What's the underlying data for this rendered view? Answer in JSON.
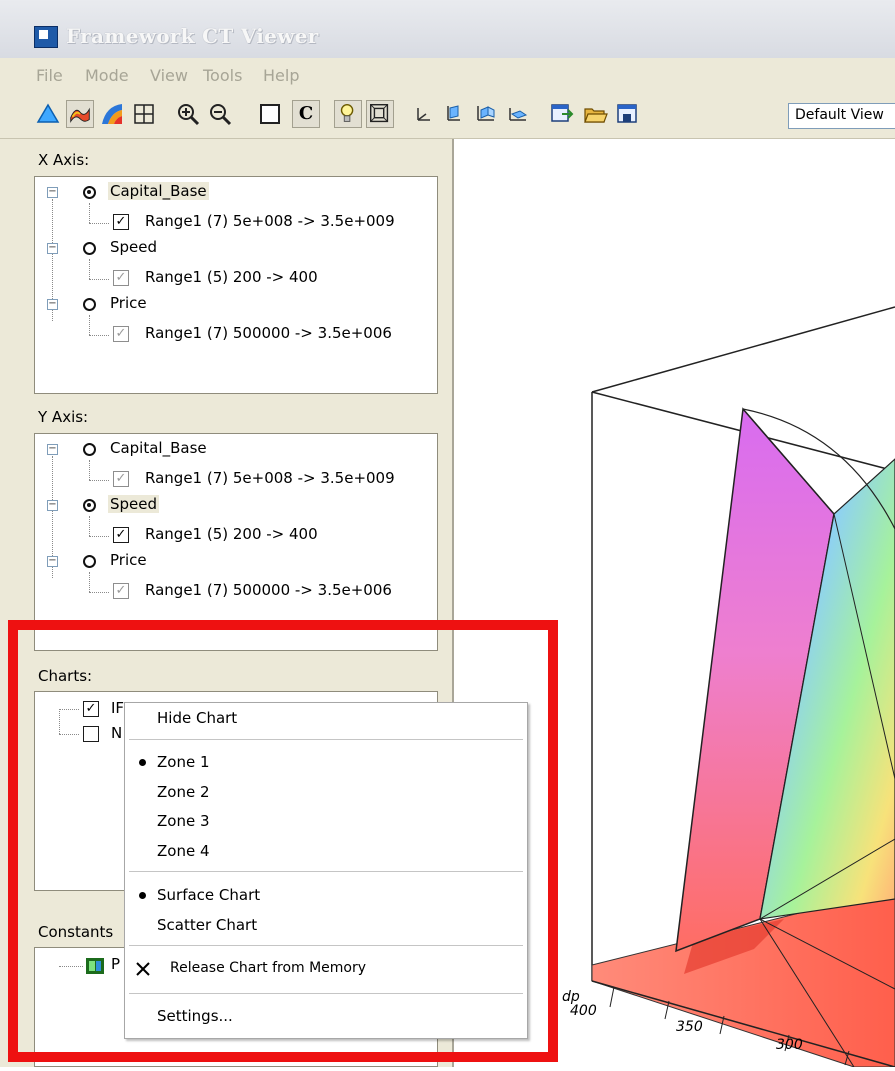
{
  "window": {
    "title": "Framework CT Viewer"
  },
  "menubar": {
    "items": [
      "File",
      "Mode",
      "View",
      "Tools",
      "Help"
    ]
  },
  "toolbar": {
    "buttons": [
      {
        "icon": "triangle-mode-icon"
      },
      {
        "icon": "surface-mode-icon"
      },
      {
        "icon": "colored-surface-icon"
      },
      {
        "icon": "grid-icon"
      },
      {
        "icon": "zoom-in-icon"
      },
      {
        "icon": "zoom-out-icon"
      },
      {
        "icon": "box-icon"
      },
      {
        "icon": "c-letter-icon"
      },
      {
        "icon": "lightbulb-icon"
      },
      {
        "icon": "frame-icon"
      },
      {
        "icon": "view-front-icon"
      },
      {
        "icon": "view-side-icon"
      },
      {
        "icon": "view-top-icon"
      },
      {
        "icon": "view-iso-icon"
      },
      {
        "icon": "export-icon"
      },
      {
        "icon": "open-folder-icon"
      },
      {
        "icon": "save-icon"
      }
    ],
    "view_combo": "Default View"
  },
  "x_axis": {
    "label": "X Axis:",
    "nodes": [
      {
        "name": "Capital_Base",
        "selected": true,
        "range": "Range1 (7)  5e+008  ->  3.5e+009",
        "range_checked": true
      },
      {
        "name": "Speed",
        "selected": false,
        "range": "Range1 (5)  200  ->  400",
        "range_checked": false
      },
      {
        "name": "Price",
        "selected": false,
        "range": "Range1 (7)  500000  ->  3.5e+006",
        "range_checked": false
      }
    ]
  },
  "y_axis": {
    "label": "Y Axis:",
    "nodes": [
      {
        "name": "Capital_Base",
        "selected": false,
        "range": "Range1 (7)  5e+008  ->  3.5e+009",
        "range_checked": false
      },
      {
        "name": "Speed",
        "selected": true,
        "range": "Range1 (5)  200  ->  400",
        "range_checked": true
      },
      {
        "name": "Price",
        "selected": false,
        "range": "Range1 (7)  500000  ->  3.5e+006",
        "range_checked": false
      }
    ]
  },
  "charts": {
    "label": "Charts:",
    "items": [
      {
        "label": "IF",
        "checked": true
      },
      {
        "label": "N",
        "checked": false
      }
    ]
  },
  "constants": {
    "label": "Constants",
    "items": [
      {
        "label": "P",
        "icon": "constant-icon"
      }
    ]
  },
  "context_menu": {
    "hide_chart": "Hide Chart",
    "zones": [
      "Zone 1",
      "Zone 2",
      "Zone 3",
      "Zone 4"
    ],
    "active_zone": "Zone 1",
    "chart_types": [
      "Surface Chart",
      "Scatter Chart"
    ],
    "active_chart_type": "Surface Chart",
    "release": "Release Chart from Memory",
    "settings": "Settings..."
  },
  "plot": {
    "axis_ticks": [
      "400",
      "350",
      "300"
    ],
    "axis_corner_label": "dp"
  },
  "colors": {
    "highlight": "#ee1111",
    "panel_bg": "#ece9d8"
  }
}
